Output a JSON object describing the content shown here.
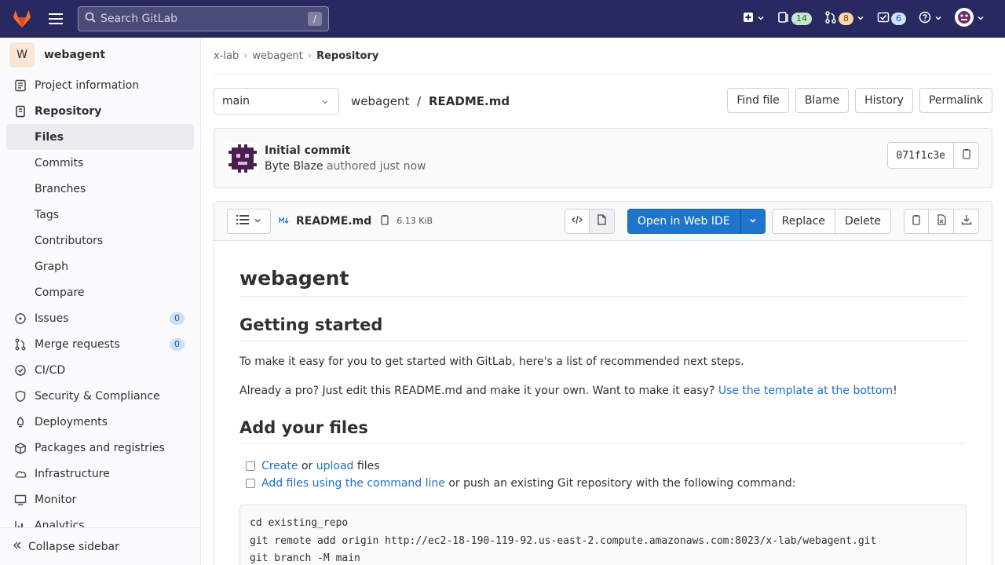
{
  "header": {
    "search_placeholder": "Search GitLab",
    "search_shortcut": "/",
    "issues_count": "14",
    "mr_count": "8",
    "todo_count": "6"
  },
  "sidebar": {
    "project_initial": "W",
    "project_name": "webagent",
    "items": [
      {
        "label": "Project information"
      },
      {
        "label": "Repository"
      },
      {
        "label": "Files"
      },
      {
        "label": "Commits"
      },
      {
        "label": "Branches"
      },
      {
        "label": "Tags"
      },
      {
        "label": "Contributors"
      },
      {
        "label": "Graph"
      },
      {
        "label": "Compare"
      },
      {
        "label": "Issues",
        "count": "0"
      },
      {
        "label": "Merge requests",
        "count": "0"
      },
      {
        "label": "CI/CD"
      },
      {
        "label": "Security & Compliance"
      },
      {
        "label": "Deployments"
      },
      {
        "label": "Packages and registries"
      },
      {
        "label": "Infrastructure"
      },
      {
        "label": "Monitor"
      },
      {
        "label": "Analytics"
      }
    ],
    "collapse_label": "Collapse sidebar"
  },
  "breadcrumb": {
    "group": "x-lab",
    "project": "webagent",
    "current": "Repository"
  },
  "toolbar": {
    "branch": "main",
    "path_project": "webagent",
    "path_sep": "/",
    "path_file": "README.md",
    "find_file": "Find file",
    "blame": "Blame",
    "history": "History",
    "permalink": "Permalink"
  },
  "commit": {
    "title": "Initial commit",
    "author": "Byte Blaze",
    "authored": "authored just now",
    "sha": "071f1c3e"
  },
  "file": {
    "name": "README.md",
    "size": "6.13 KiB",
    "open_ide": "Open in Web IDE",
    "replace": "Replace",
    "delete": "Delete"
  },
  "readme": {
    "h1": "webagent",
    "h2_getting_started": "Getting started",
    "p1": "To make it easy for you to get started with GitLab, here's a list of recommended next steps.",
    "p2_text": "Already a pro? Just edit this README.md and make it your own. Want to make it easy? ",
    "p2_link": "Use the template at the bottom",
    "p2_end": "!",
    "h2_add_files": "Add your files",
    "task1_link1": "Create",
    "task1_mid": " or ",
    "task1_link2": "upload",
    "task1_end": " files",
    "task2_link": "Add files using the command line",
    "task2_end": " or push an existing Git repository with the following command:",
    "code_lines": [
      "cd existing_repo",
      "git remote add origin http://ec2-18-190-119-92.us-east-2.compute.amazonaws.com:8023/x-lab/webagent.git",
      "git branch -M main"
    ]
  }
}
